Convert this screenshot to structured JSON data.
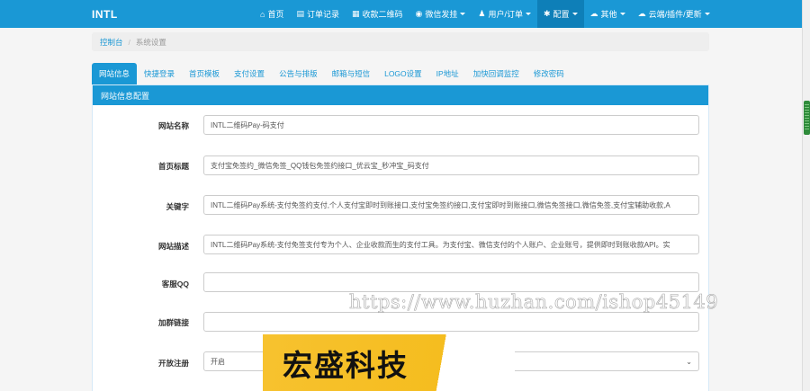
{
  "navbar": {
    "brand": "INTL",
    "items": [
      {
        "icon": "home-icon",
        "glyph": "⌂",
        "label": "首页",
        "caret": false,
        "active": false
      },
      {
        "icon": "list-icon",
        "glyph": "▤",
        "label": "订单记录",
        "caret": false,
        "active": false
      },
      {
        "icon": "qrcode-icon",
        "glyph": "▦",
        "label": "收款二维码",
        "caret": false,
        "active": false
      },
      {
        "icon": "wechat-icon",
        "glyph": "◉",
        "label": "微信发挂",
        "caret": true,
        "active": false
      },
      {
        "icon": "user-icon",
        "glyph": "♟",
        "label": "用户/订单",
        "caret": true,
        "active": false
      },
      {
        "icon": "gear-icon",
        "glyph": "✱",
        "label": "配置",
        "caret": true,
        "active": true
      },
      {
        "icon": "other-icon",
        "glyph": "☁",
        "label": "其他",
        "caret": true,
        "active": false
      },
      {
        "icon": "cloud-icon",
        "glyph": "☁",
        "label": "云端/插件/更新",
        "caret": true,
        "active": false
      }
    ]
  },
  "breadcrumb": {
    "home": "控制台",
    "separator": "/",
    "current": "系统设置"
  },
  "tabs": [
    "网站信息",
    "快捷登录",
    "首页模板",
    "支付设置",
    "公告与排版",
    "邮箱与短信",
    "LOGO设置",
    "IP地址",
    "加快回调监控",
    "修改密码"
  ],
  "panel": {
    "title": "网站信息配置"
  },
  "form": {
    "site_name": {
      "label": "网站名称",
      "value": "INTL二维码Pay-码支付"
    },
    "home_title": {
      "label": "首页标题",
      "value": "支付宝免签约_微信免签_QQ钱包免签约接口_优云宝_秒冲宝_码支付"
    },
    "keywords": {
      "label": "关键字",
      "value": "INTL二维码Pay系统-支付免签约支付,个人支付宝即时到账接口,支付宝免签约接口,支付宝即时到账接口,微信免签接口,微信免签,支付宝辅助收款,A"
    },
    "description": {
      "label": "网站描述",
      "value": "INTL二维码Pay系统-支付免签支付专为个人、企业收款而生的支付工具。为支付宝、微信支付的个人账户、企业账号，提供即时到账收款API。实"
    },
    "service_qq": {
      "label": "客服QQ",
      "value": ""
    },
    "group_link": {
      "label": "加群链接",
      "value": ""
    },
    "open_register": {
      "label": "开放注册",
      "value": "开启"
    }
  },
  "overlay": {
    "watermark": "https://www.huzhan.com/ishop45149",
    "banner": "宏盛科技"
  }
}
